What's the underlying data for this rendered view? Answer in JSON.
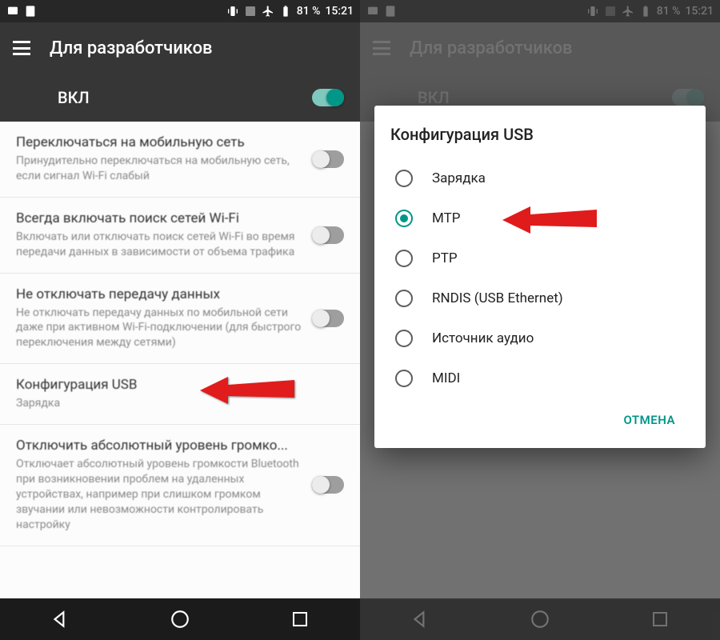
{
  "status": {
    "battery": "81 %",
    "time": "15:21"
  },
  "appbar": {
    "title": "Для разработчиков"
  },
  "master_toggle": {
    "label": "ВКЛ"
  },
  "settings": [
    {
      "title": "Переключаться на мобильную сеть",
      "sub": "Принудительно переключаться на мобильную сеть, если сигнал Wi-Fi слабый"
    },
    {
      "title": "Всегда включать поиск сетей Wi-Fi",
      "sub": "Включать или отключать поиск сетей Wi-Fi во время передачи данных в зависимости от объема трафика"
    },
    {
      "title": "Не отключать передачу данных",
      "sub": "Не отключать передачу данных по мобильной сети даже при активном Wi-Fi-подключении (для быстрого переключения между сетями)"
    },
    {
      "title": "Конфигурация USB",
      "sub": "Зарядка"
    },
    {
      "title": "Отключить абсолютный уровень громко...",
      "sub": "Отключает абсолютный уровень громкости Bluetooth при возникновении проблем на удаленных устройствах, например при слишком громком звучании или невозможности контролировать настройку"
    }
  ],
  "dialog": {
    "title": "Конфигурация USB",
    "options": [
      "Зарядка",
      "MTP",
      "PTP",
      "RNDIS (USB Ethernet)",
      "Источник аудио",
      "MIDI"
    ],
    "cancel": "ОТМЕНА"
  }
}
